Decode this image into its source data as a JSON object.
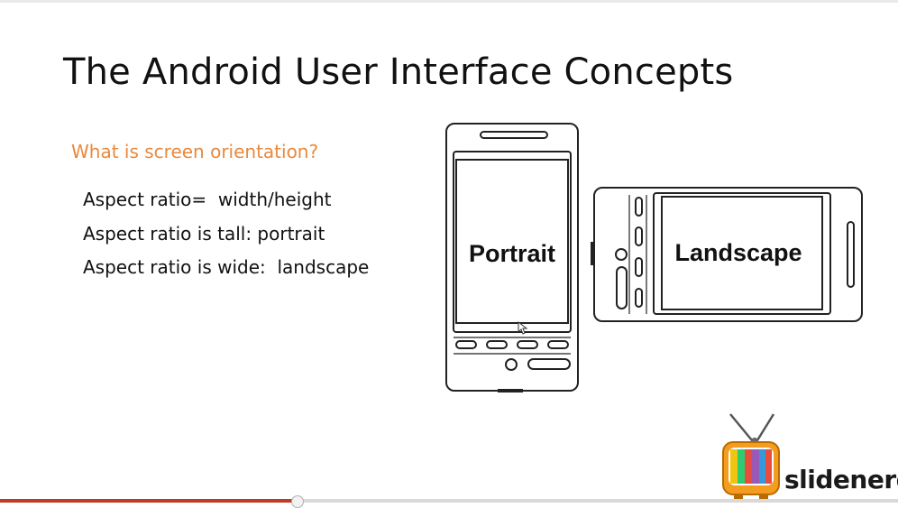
{
  "slide": {
    "title": "The Android User Interface Concepts",
    "subtitle": "What is screen orientation?",
    "bullets": [
      "Aspect ratio=  width/height",
      "Aspect ratio is tall: portrait",
      "Aspect ratio is wide:  landscape"
    ]
  },
  "illustration": {
    "portrait_label": "Portrait",
    "landscape_label": "Landscape"
  },
  "logo": {
    "wordmark": "slidenerd"
  },
  "playback": {
    "progress_percent": 33
  }
}
